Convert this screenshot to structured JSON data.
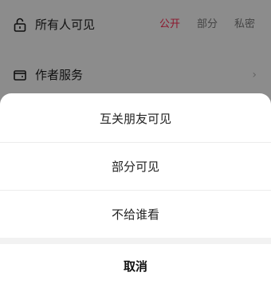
{
  "settings": {
    "visibility_label": "所有人可见",
    "visibility_options": [
      "公开",
      "部分",
      "私密"
    ],
    "visibility_selected": "公开",
    "author_service_label": "作者服务",
    "author_service_chevron": "›",
    "icons": {
      "visibility": "unlock-icon",
      "author_service": "wallet-icon"
    }
  },
  "sheet": {
    "options": [
      "互关朋友可见",
      "部分可见",
      "不给谁看"
    ],
    "cancel_label": "取消"
  },
  "colors": {
    "accent": "#ff2b55",
    "dim_overlay": "rgba(0,0,0,0.45)"
  }
}
